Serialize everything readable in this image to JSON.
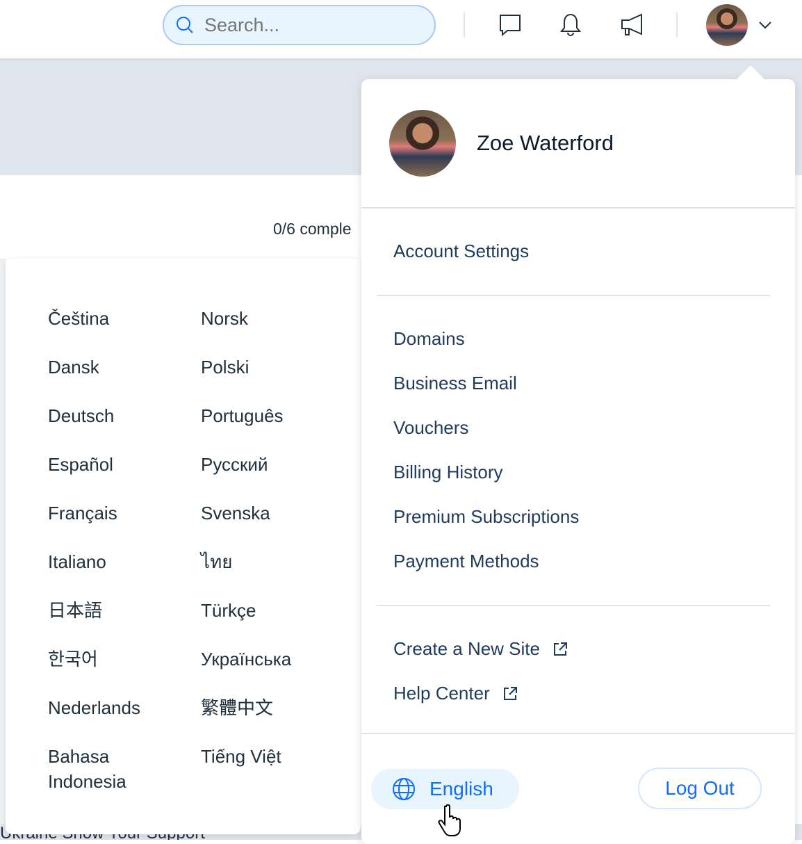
{
  "header": {
    "search_placeholder": "Search...",
    "icons": [
      "chat-icon",
      "bell-icon",
      "megaphone-icon"
    ]
  },
  "main": {
    "progress": "0/6 comple",
    "banner": "Ukraine  Show Your Support  ^"
  },
  "languages": [
    "Čeština",
    "Norsk",
    "Dansk",
    "Polski",
    "Deutsch",
    "Português",
    "Español",
    "Русский",
    "Français",
    "Svenska",
    "Italiano",
    "ไทย",
    "日本語",
    "Türkçe",
    "한국어",
    "Українська",
    "Nederlands",
    "繁體中文",
    "Bahasa Indonesia",
    "Tiếng Việt"
  ],
  "account": {
    "user_name": "Zoe Waterford",
    "settings": "Account Settings",
    "items": [
      "Domains",
      "Business Email",
      "Vouchers",
      "Billing History",
      "Premium Subscriptions",
      "Payment Methods"
    ],
    "links": [
      "Create a New Site",
      "Help Center"
    ],
    "language": "English",
    "logout": "Log Out"
  },
  "colors": {
    "accent": "#116dff",
    "text": "#1f3b5c"
  }
}
